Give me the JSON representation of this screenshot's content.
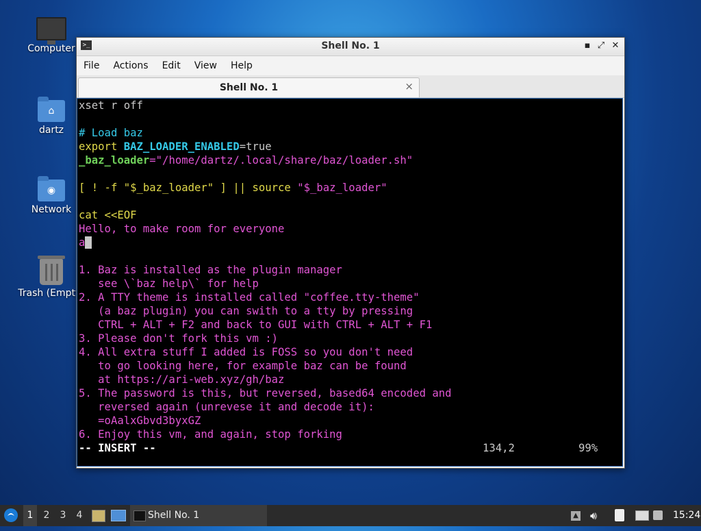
{
  "desktop": {
    "icons": [
      {
        "label": "Computer",
        "icon": "computer-icon"
      },
      {
        "label": "dartz",
        "icon": "home-folder-icon"
      },
      {
        "label": "Network",
        "icon": "network-folder-icon"
      },
      {
        "label": "Trash (Empty)",
        "icon": "trash-icon"
      }
    ]
  },
  "window": {
    "title": "Shell No. 1",
    "buttons": {
      "minimize": "▪",
      "maximize": "⤢",
      "close": "✕"
    },
    "menu": [
      "File",
      "Actions",
      "Edit",
      "View",
      "Help"
    ],
    "tab": {
      "label": "Shell No. 1",
      "close": "×"
    }
  },
  "terminal": {
    "lines": [
      [
        {
          "t": "xset r off",
          "c": "plain"
        }
      ],
      [
        {
          "t": "",
          "c": "plain"
        }
      ],
      [
        {
          "t": "# Load baz",
          "c": "cyan"
        }
      ],
      [
        {
          "t": "export ",
          "c": "yellow"
        },
        {
          "t": "BAZ_LOADER_ENABLED",
          "c": "cyan-bold"
        },
        {
          "t": "=true",
          "c": "plain"
        }
      ],
      [
        {
          "t": "_baz_loader",
          "c": "green-bold"
        },
        {
          "t": "=\"/home/dartz/.local/share/baz/loader.sh\"",
          "c": "magenta"
        }
      ],
      [
        {
          "t": "",
          "c": "plain"
        }
      ],
      [
        {
          "t": "[ ! -f \"$_baz_loader\" ] || ",
          "c": "yellow"
        },
        {
          "t": "source ",
          "c": "yellow"
        },
        {
          "t": "\"$_baz_loader\"",
          "c": "magenta"
        }
      ],
      [
        {
          "t": "",
          "c": "plain"
        }
      ],
      [
        {
          "t": "cat <<EOF",
          "c": "yellow"
        }
      ],
      [
        {
          "t": "Hello, to make room for everyone",
          "c": "magenta"
        }
      ],
      [
        {
          "t": "a",
          "c": "magenta"
        },
        {
          "t": " ",
          "c": "cursor"
        }
      ],
      [
        {
          "t": "",
          "c": "plain"
        }
      ],
      [
        {
          "t": "1. Baz is installed as the plugin manager",
          "c": "magenta"
        }
      ],
      [
        {
          "t": "   see \\`baz help\\` for help",
          "c": "magenta"
        }
      ],
      [
        {
          "t": "2. A TTY theme is installed called \"coffee.tty-theme\"",
          "c": "magenta"
        }
      ],
      [
        {
          "t": "   (a baz plugin) you can swith to a tty by pressing",
          "c": "magenta"
        }
      ],
      [
        {
          "t": "   CTRL + ALT + F2 and back to GUI with CTRL + ALT + F1",
          "c": "magenta"
        }
      ],
      [
        {
          "t": "3. Please don't fork this vm :)",
          "c": "magenta"
        }
      ],
      [
        {
          "t": "4. All extra stuff I added is FOSS so you don't need",
          "c": "magenta"
        }
      ],
      [
        {
          "t": "   to go looking here, for example baz can be found",
          "c": "magenta"
        }
      ],
      [
        {
          "t": "   at https://ari-web.xyz/gh/baz",
          "c": "magenta"
        }
      ],
      [
        {
          "t": "5. The password is this, but reversed, based64 encoded and",
          "c": "magenta"
        }
      ],
      [
        {
          "t": "   reversed again (unrevese it and decode it):",
          "c": "magenta"
        }
      ],
      [
        {
          "t": "   =oAalxGbvd3byxGZ",
          "c": "magenta"
        }
      ],
      [
        {
          "t": "6. Enjoy this vm, and again, stop forking",
          "c": "magenta"
        }
      ]
    ],
    "status": {
      "mode": "-- INSERT --",
      "position": "134,2",
      "percent": "99%"
    }
  },
  "taskbar": {
    "workspaces": [
      "1",
      "2",
      "3",
      "4"
    ],
    "active_workspace": "1",
    "task_label": "Shell No. 1",
    "clock": "15:24"
  }
}
